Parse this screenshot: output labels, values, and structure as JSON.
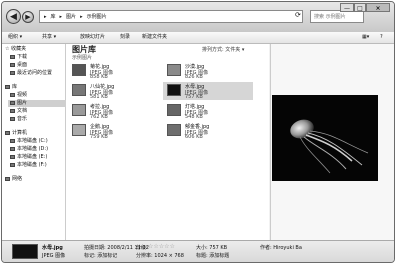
{
  "address": [
    "库",
    "图片",
    "示例图片"
  ],
  "search_placeholder": "搜索 示例图片",
  "window_controls": [
    "—",
    "□",
    "×"
  ],
  "toolbar": {
    "organize": "组织 ▾",
    "share": "共享 ▾",
    "slideshow": "放映幻灯片",
    "burn": "刻录",
    "new_folder": "新建文件夹"
  },
  "nav": {
    "favorites": "☆ 收藏夹",
    "downloads": "下载",
    "desktop": "桌面",
    "recent": "最近访问的位置",
    "libraries": "库",
    "videos": "视频",
    "pictures": "图片",
    "documents": "文档",
    "music": "音乐",
    "computer": "计算机",
    "drive_c": "本地磁盘 (C:)",
    "drive_d": "本地磁盘 (D:)",
    "drive_e": "本地磁盘 (E:)",
    "drive_f": "本地磁盘 (F:)",
    "network": "网络"
  },
  "library": {
    "title": "图片库",
    "subtitle": "示例图片",
    "arrange": "排列方式: 文件夹 ▾"
  },
  "files": [
    {
      "name": "菊花.jpg",
      "type": "JPEG 图像",
      "size": "858 KB"
    },
    {
      "name": "沙漠.jpg",
      "type": "JPEG 图像",
      "size": "826 KB"
    },
    {
      "name": "八仙花.jpg",
      "type": "JPEG 图像",
      "size": "581 KB"
    },
    {
      "name": "水母.jpg",
      "type": "JPEG 图像",
      "size": "757 KB"
    },
    {
      "name": "考拉.jpg",
      "type": "JPEG 图像",
      "size": "762 KB"
    },
    {
      "name": "灯塔.jpg",
      "type": "JPEG 图像",
      "size": "548 KB"
    },
    {
      "name": "企鹅.jpg",
      "type": "JPEG 图像",
      "size": "759 KB"
    },
    {
      "name": "郁金香.jpg",
      "type": "JPEG 图像",
      "size": "606 KB"
    }
  ],
  "details": {
    "name": "水母.jpg",
    "type": "JPEG 图像",
    "date_label": "拍摄日期: 2008/2/11 11:32",
    "rating_label": "分级:",
    "stars": "☆☆☆☆☆",
    "tags": "标记: 添加标记",
    "dims": "分辨率: 1024 × 768",
    "size": "大小: 757 KB",
    "title": "标题: 添加标题",
    "author": "作者: Hiroyuki Ba"
  }
}
